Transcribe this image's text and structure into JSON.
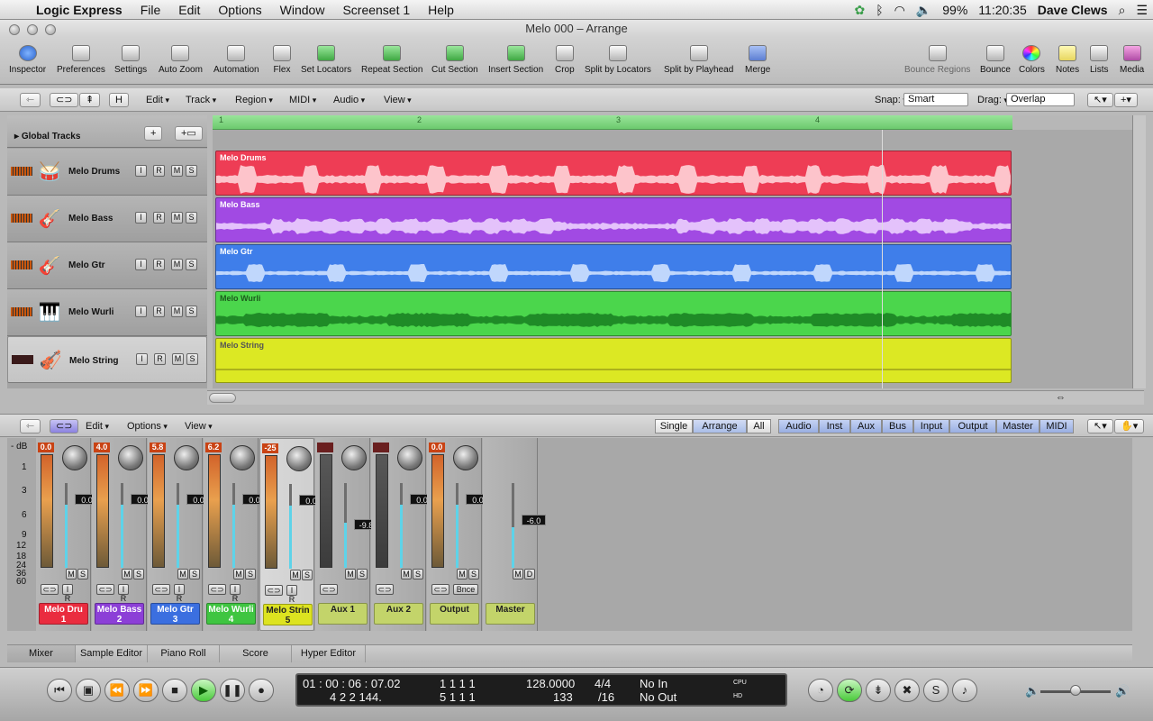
{
  "menubar": {
    "app": "Logic Express",
    "items": [
      "File",
      "Edit",
      "Options",
      "Window",
      "Screenset 1",
      "Help"
    ],
    "battery": "99%",
    "clock": "11:20:35",
    "user": "Dave Clews"
  },
  "window": {
    "title": "Melo 000 – Arrange"
  },
  "toolbar": {
    "left": [
      "Inspector",
      "Preferences",
      "Settings",
      "Auto Zoom",
      "Automation",
      "Flex",
      "Set Locators",
      "Repeat Section",
      "Cut Section",
      "Insert Section",
      "Crop",
      "Split by Locators",
      "Split by Playhead",
      "Merge"
    ],
    "right": [
      "Bounce Regions",
      "Bounce",
      "Colors",
      "Notes",
      "Lists",
      "Media"
    ]
  },
  "arrange_bar": {
    "menus": [
      "Edit",
      "Track",
      "Region",
      "MIDI",
      "Audio",
      "View"
    ],
    "h_button": "H",
    "snap_label": "Snap:",
    "snap_value": "Smart",
    "drag_label": "Drag:",
    "drag_value": "Overlap"
  },
  "global_tracks": {
    "label": "Global Tracks"
  },
  "ruler": {
    "bars": [
      "1",
      "2",
      "3",
      "4"
    ]
  },
  "tracks": [
    {
      "name": "Melo Drums",
      "region": "Melo Drums",
      "color": "#ee3d55",
      "icon": "drums-icon"
    },
    {
      "name": "Melo Bass",
      "region": "Melo Bass",
      "color": "#a14ae3",
      "icon": "bass-guitar-icon"
    },
    {
      "name": "Melo Gtr",
      "region": "Melo Gtr",
      "color": "#3f7eea",
      "icon": "guitar-icon"
    },
    {
      "name": "Melo Wurli",
      "region": "Melo Wurli",
      "color": "#4bd64c",
      "icon": "keyboard-icon"
    },
    {
      "name": "Melo String",
      "region": "Melo String",
      "color": "#dce823",
      "icon": "violin-icon"
    }
  ],
  "track_buttons": [
    "I",
    "R",
    "M",
    "S"
  ],
  "mixer_bar": {
    "menus": [
      "Edit",
      "Options",
      "View"
    ],
    "views": [
      "Single",
      "Arrange",
      "All"
    ],
    "filters": [
      "Audio",
      "Inst",
      "Aux",
      "Bus",
      "Input",
      "Output",
      "Master",
      "MIDI"
    ]
  },
  "mixer": {
    "scale": [
      "- dB",
      "1",
      "3",
      "6",
      "9",
      "12",
      "18",
      "24",
      "36",
      "60"
    ],
    "strips": [
      {
        "peak": "0.0",
        "vol": "0.0",
        "name": "Melo Dru",
        "num": "1",
        "color": "#ea2c3f",
        "bottom": "I R"
      },
      {
        "peak": "4.0",
        "vol": "0.0",
        "name": "Melo Bass",
        "num": "2",
        "color": "#8c3fd7",
        "bottom": "I R"
      },
      {
        "peak": "5.8",
        "vol": "0.0",
        "name": "Melo Gtr",
        "num": "3",
        "color": "#3b6fe0",
        "bottom": "I R"
      },
      {
        "peak": "6.2",
        "vol": "0.0",
        "name": "Melo Wurli",
        "num": "4",
        "color": "#3fc541",
        "bottom": "I R"
      },
      {
        "peak": "-25",
        "vol": "0.0",
        "name": "Melo Strin",
        "num": "5",
        "color": "#dde320",
        "bottom": "I R"
      },
      {
        "peak": "",
        "vol": "-9.8",
        "name": "Aux 1",
        "num": "",
        "color": "#c3d46a",
        "bottom": ""
      },
      {
        "peak": "",
        "vol": "0.0",
        "name": "Aux 2",
        "num": "",
        "color": "#c3d46a",
        "bottom": ""
      },
      {
        "peak": "0.0",
        "vol": "0.0",
        "name": "Output",
        "num": "",
        "color": "#c3d46a",
        "bottom": "Bnce"
      },
      {
        "peak": "",
        "vol": "-6.0",
        "name": "Master",
        "num": "",
        "color": "#c3d46a",
        "bottom": ""
      }
    ]
  },
  "tabs": [
    "Mixer",
    "Sample Editor",
    "Piano Roll",
    "Score",
    "Hyper Editor"
  ],
  "lcd": {
    "smpte": "01 : 00 : 06 : 07.02",
    "beats": "4   2   2  144.",
    "pos1": "1    1    1      1",
    "pos2": "5    1    1      1",
    "tempo": "128.0000",
    "bpm_sub": "133",
    "sig": "4/4",
    "div": "/16",
    "in": "No In",
    "out": "No Out",
    "cpu": "CPU",
    "hd": "HD"
  }
}
